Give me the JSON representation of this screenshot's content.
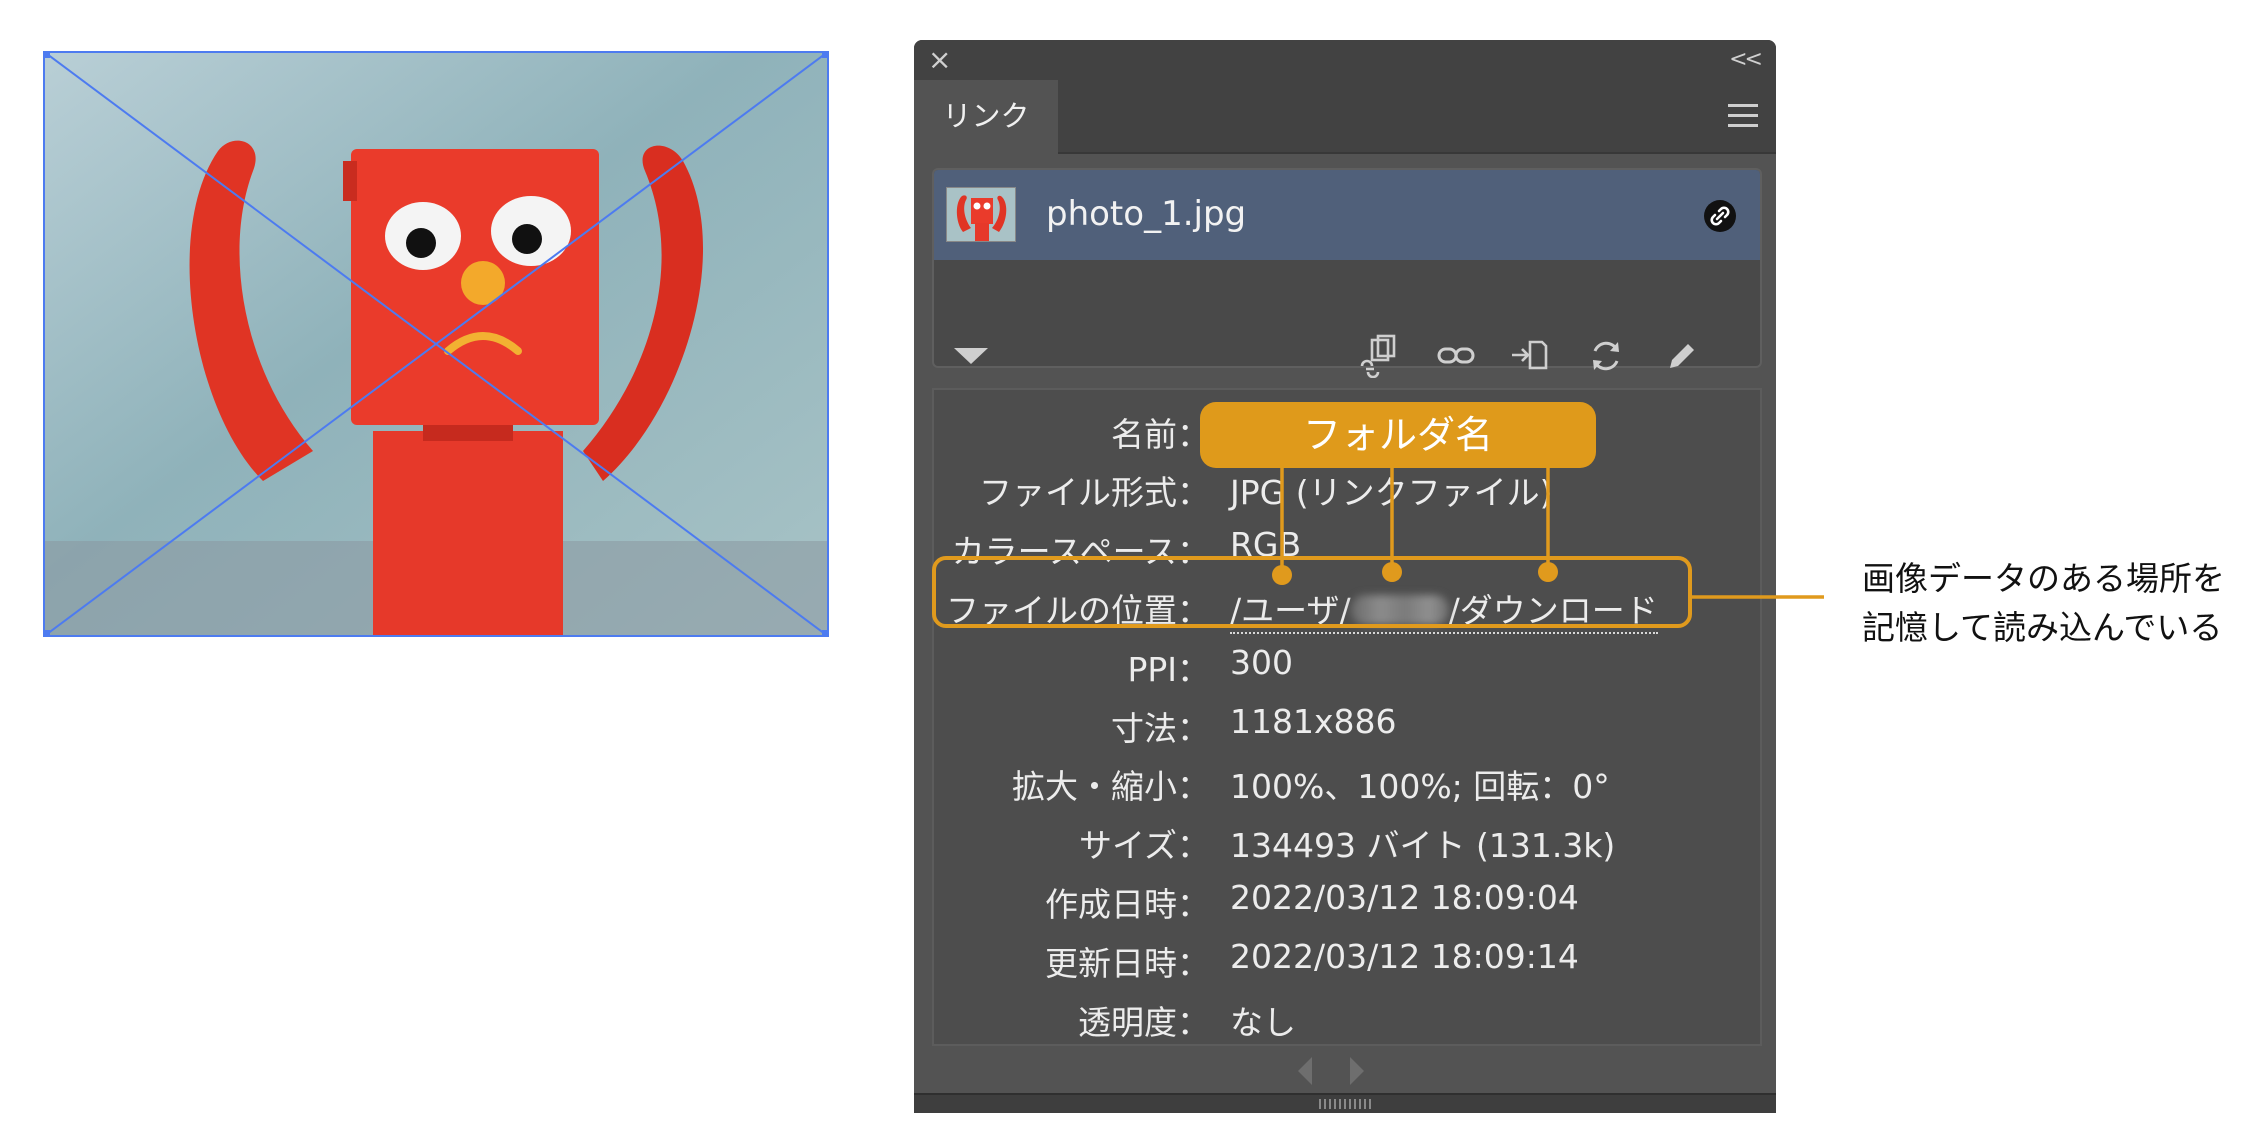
{
  "panel": {
    "close_glyph": "×",
    "collapse_glyph": "<<",
    "tab_label": "リンク",
    "link_item": {
      "file_name": "photo_1.jpg"
    },
    "info_rows": [
      {
        "label": "名前：",
        "value": ""
      },
      {
        "label": "ファイル形式：",
        "value": "JPG (リンクファイル)"
      },
      {
        "label": "カラースペース：",
        "value": "RGB"
      },
      {
        "label": "ファイルの位置：",
        "value_prefix": "/ユーザ/",
        "value_suffix": "/ダウンロード"
      },
      {
        "label": "PPI：",
        "value": "300"
      },
      {
        "label": "寸法：",
        "value": "1181x886"
      },
      {
        "label": "拡大・縮小：",
        "value": "100%、100%; 回転：0°"
      },
      {
        "label": "サイズ：",
        "value": "134493 バイト (131.3k)"
      },
      {
        "label": "作成日時：",
        "value": "2022/03/12 18:09:04"
      },
      {
        "label": "更新日時：",
        "value": "2022/03/12 18:09:14"
      },
      {
        "label": "透明度：",
        "value": "なし"
      }
    ]
  },
  "annotations": {
    "folder_label": "フォルダ名",
    "side_note_line1": "画像データのある場所を",
    "side_note_line2": "記憶して読み込んでいる",
    "accent_color": "#e09a1d"
  },
  "colors": {
    "panel_bg": "#535353",
    "selected_row": "#50607a",
    "bounding_box": "#4d7bf0"
  }
}
